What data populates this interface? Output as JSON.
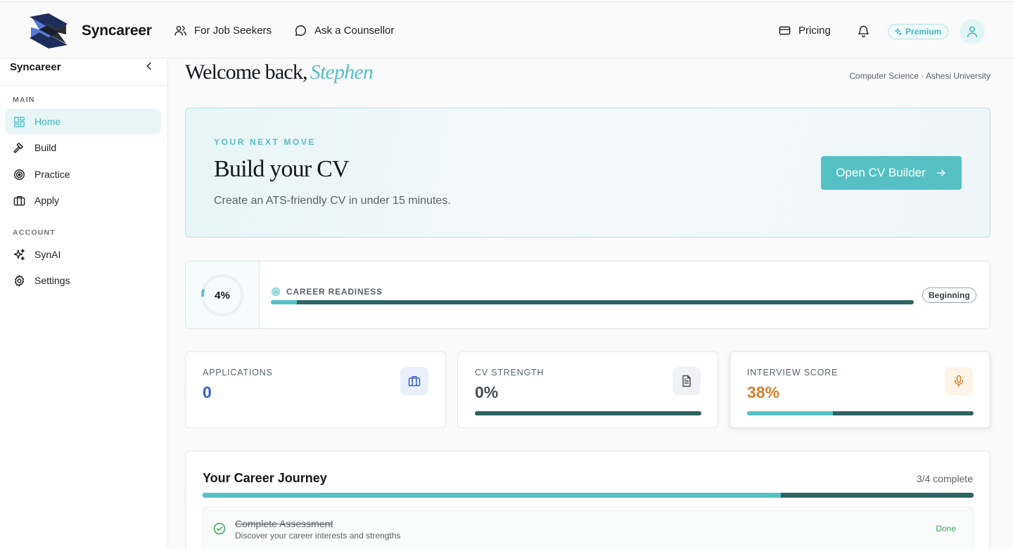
{
  "colors": {
    "accent": "#55c1c5",
    "dark_track": "#2e6461",
    "brand_navy": "#1f2d5c",
    "applications_value": "#3a5fcd",
    "interview_value": "#d67f2b",
    "done_green": "#3aa55a"
  },
  "header": {
    "brand": "Syncareer",
    "logo_icon": "syncareer-logo",
    "nav": [
      {
        "label": "For Job Seekers",
        "icon": "users-icon"
      },
      {
        "label": "Ask a Counsellor",
        "icon": "chat-bubble-icon"
      }
    ],
    "pricing": {
      "label": "Pricing",
      "icon": "credit-card-icon"
    },
    "notifications_icon": "bell-icon",
    "premium_badge": "Premium",
    "avatar_icon": "user-icon"
  },
  "sidebar": {
    "title": "Syncareer",
    "collapse_icon": "chevron-left-icon",
    "sections": [
      {
        "label": "MAIN"
      },
      {
        "label": "ACCOUNT"
      }
    ],
    "items": [
      {
        "label": "Home",
        "icon": "layout-grid-icon",
        "active": true
      },
      {
        "label": "Build",
        "icon": "hammer-icon",
        "active": false
      },
      {
        "label": "Practice",
        "icon": "target-icon",
        "active": false
      },
      {
        "label": "Apply",
        "icon": "briefcase-icon",
        "active": false
      },
      {
        "label": "SynAI",
        "icon": "sparkles-icon",
        "active": false
      },
      {
        "label": "Settings",
        "icon": "gear-icon",
        "active": false
      }
    ]
  },
  "welcome": {
    "prefix": "Welcome back,",
    "name": "Stephen",
    "program": "Computer Science · Ashesi University"
  },
  "hero": {
    "eyebrow": "YOUR NEXT MOVE",
    "title": "Build your CV",
    "subtitle": "Create an ATS-friendly CV in under 15 minutes.",
    "button": "Open CV Builder"
  },
  "readiness": {
    "percent_text": "4%",
    "progress": 0.04,
    "label": "CAREER READINESS",
    "badge": "Beginning"
  },
  "stats": [
    {
      "label": "APPLICATIONS",
      "value": "0",
      "icon": "briefcase-icon"
    },
    {
      "label": "CV STRENGTH",
      "value": "0%",
      "icon": "document-icon",
      "progress": 0.0
    },
    {
      "label": "INTERVIEW SCORE",
      "value": "38%",
      "icon": "microphone-icon",
      "progress": 0.38
    }
  ],
  "journey": {
    "title": "Your Career Journey",
    "count": "3/4 complete",
    "progress": 0.75,
    "steps": [
      {
        "title": "Complete Assessment",
        "description": "Discover your career interests and strengths",
        "status": "Done",
        "icon": "check-circle-icon"
      }
    ]
  }
}
